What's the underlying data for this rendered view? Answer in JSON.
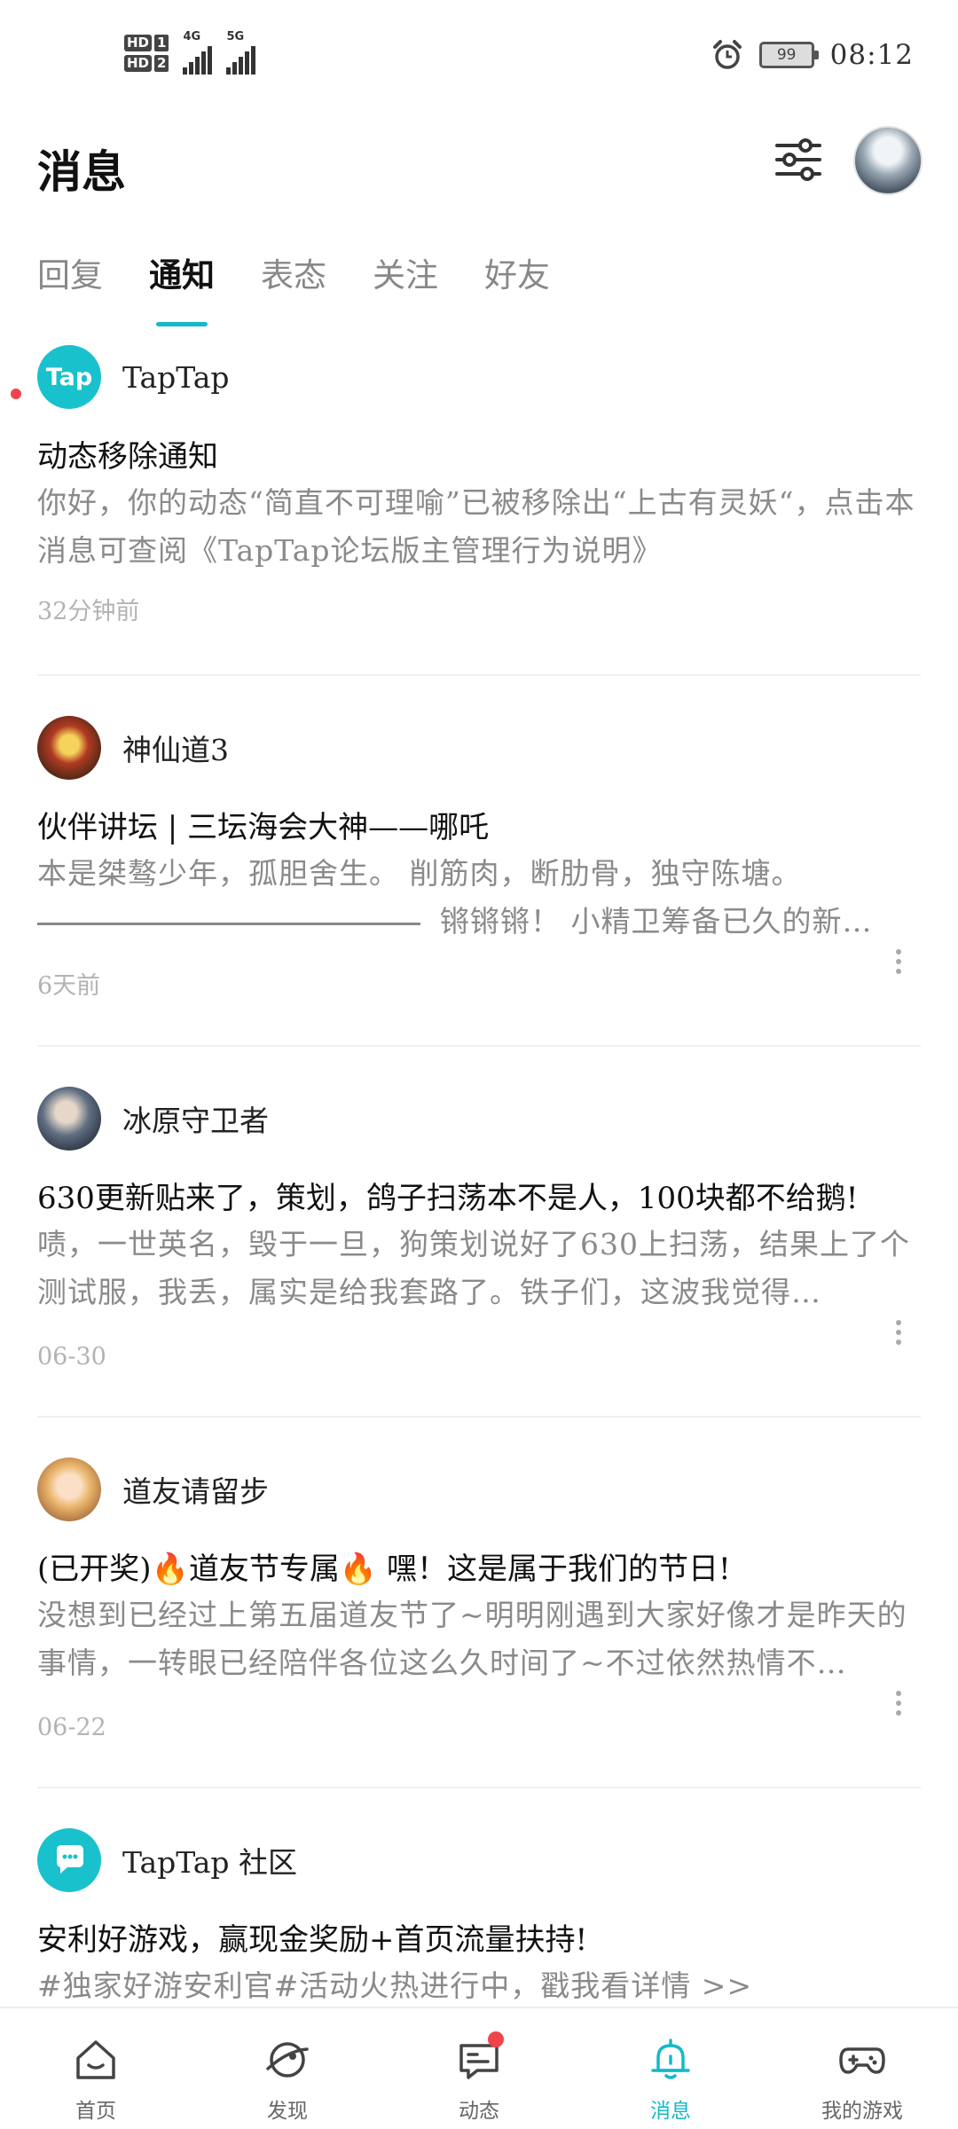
{
  "status_bar": {
    "sim1": "HD",
    "sim1_num": "1",
    "sim2": "HD",
    "sim2_num": "2",
    "net1": "4G",
    "net2": "5G",
    "battery": "99",
    "time": "08:12"
  },
  "header": {
    "title": "消息"
  },
  "tabs": [
    {
      "label": "回复",
      "active": false
    },
    {
      "label": "通知",
      "active": true
    },
    {
      "label": "表态",
      "active": false
    },
    {
      "label": "关注",
      "active": false
    },
    {
      "label": "好友",
      "active": false
    }
  ],
  "messages": [
    {
      "author": "TapTap",
      "avatar_text": "Tap",
      "title": "动态移除通知",
      "body": "你好，你的动态“简直不可理喻”已被移除出“上古有灵妖“，点击本消息可查阅《TapTap论坛版主管理行为说明》",
      "time": "32分钟前"
    },
    {
      "author": "神仙道3",
      "title": "伙伴讲坛 | 三坛海会大神——哪吒",
      "body_line1": "本是桀骜少年，孤胆舍生。 削筋肉，断肋骨，独守陈塘。",
      "body_line2": "锵锵锵！ 小精卫筹备已久的新…",
      "time": "6天前"
    },
    {
      "author": "冰原守卫者",
      "title": "630更新贴来了，策划，鸽子扫荡本不是人，100块都不给鹅!",
      "body": "啧，一世英名，毁于一旦，狗策划说好了630上扫荡，结果上了个测试服，我丢，属实是给我套路了。铁子们，这波我觉得…",
      "time": "06-30"
    },
    {
      "author": "道友请留步",
      "title": "(已开奖)🔥道友节专属🔥 嘿！这是属于我们的节日!",
      "body": "没想到已经过上第五届道友节了~明明刚遇到大家好像才是昨天的事情，一转眼已经陪伴各位这么久时间了~不过依然热情不…",
      "time": "06-22"
    },
    {
      "author": "TapTap 社区",
      "title": "安利好游戏，赢现金奖励+首页流量扶持!",
      "body": "#独家好游安利官#活动火热进行中，戳我看详情 >>"
    }
  ],
  "nav": [
    {
      "label": "首页",
      "icon": "home-icon"
    },
    {
      "label": "发现",
      "icon": "discover-icon"
    },
    {
      "label": "动态",
      "icon": "feed-icon"
    },
    {
      "label": "消息",
      "icon": "bell-icon",
      "active": true
    },
    {
      "label": "我的游戏",
      "icon": "gamepad-icon"
    }
  ],
  "colors": {
    "accent": "#14b9c8",
    "badge": "#f0434c"
  }
}
